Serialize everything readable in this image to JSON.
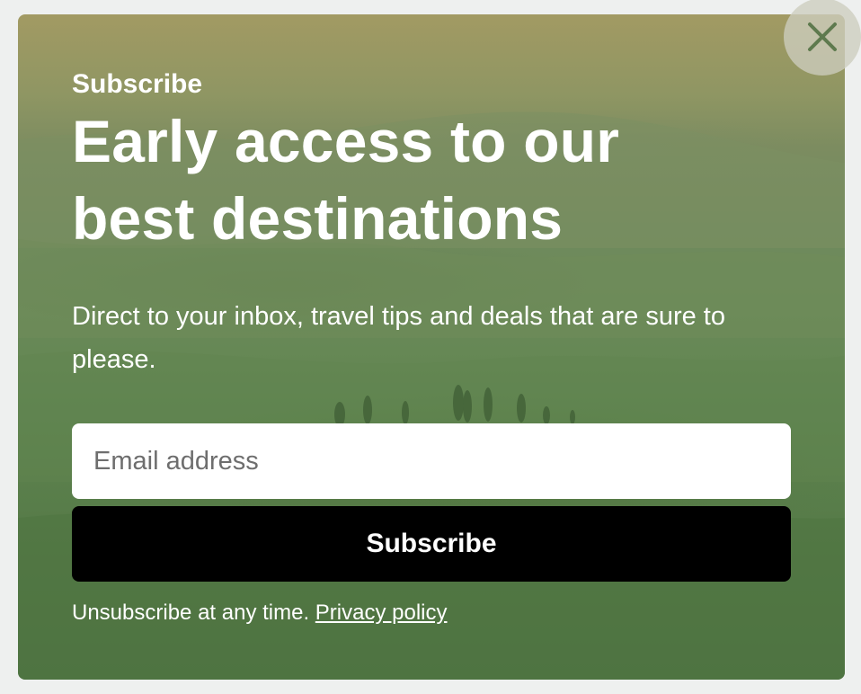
{
  "popup": {
    "eyebrow": "Subscribe",
    "headline": "Early access to our best destinations",
    "description": "Direct to your inbox, travel tips and deals that are sure to please.",
    "email_placeholder": "Email address",
    "email_value": "",
    "submit_label": "Subscribe",
    "footer_text": "Unsubscribe at any time.",
    "privacy_link": "Privacy policy",
    "close_icon": "close-icon"
  },
  "colors": {
    "overlay_green": "#6a8a58",
    "button_bg": "#000000",
    "text": "#ffffff",
    "close_icon_color": "#5e7a4e"
  }
}
